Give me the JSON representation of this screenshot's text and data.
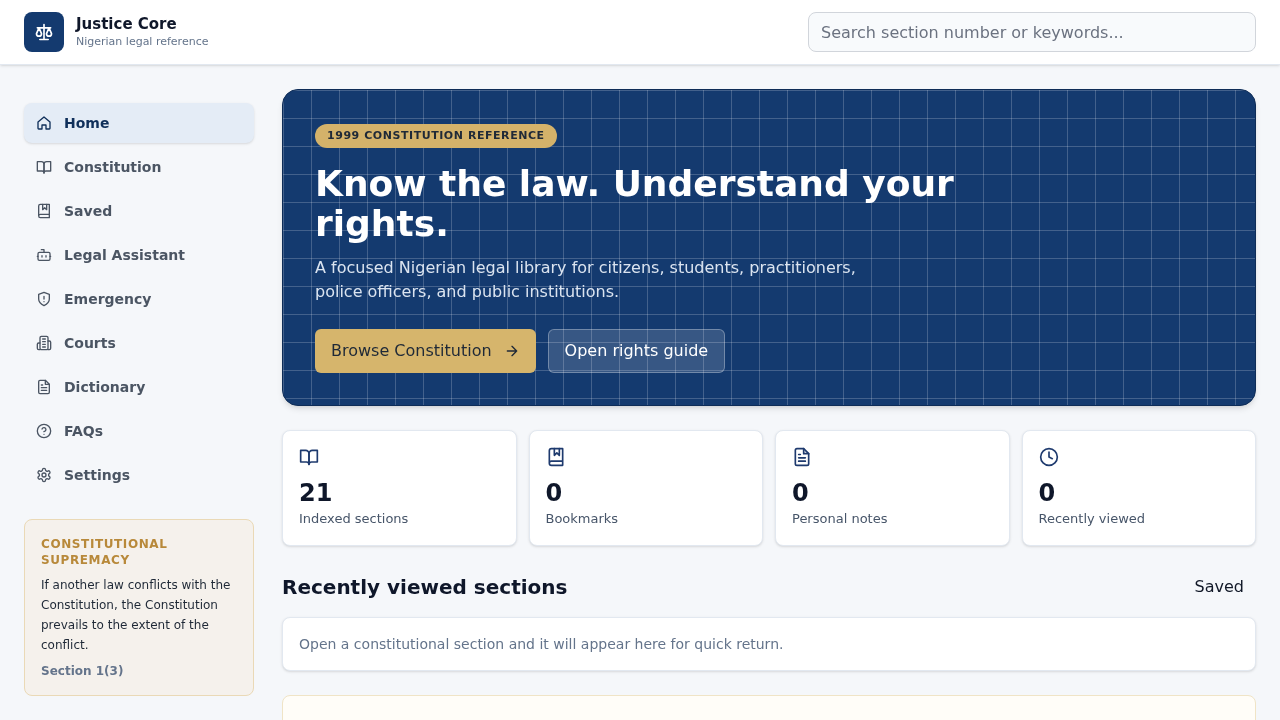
{
  "header": {
    "app_title": "Justice Core",
    "app_subtitle": "Nigerian legal reference",
    "search": {
      "placeholder": "Search section number or keywords..."
    }
  },
  "sidebar": {
    "items": [
      {
        "label": "Home",
        "selected": true
      },
      {
        "label": "Constitution",
        "selected": false
      },
      {
        "label": "Saved",
        "selected": false
      },
      {
        "label": "Legal Assistant",
        "selected": false
      },
      {
        "label": "Emergency",
        "selected": false
      },
      {
        "label": "Courts",
        "selected": false
      },
      {
        "label": "Dictionary",
        "selected": false
      },
      {
        "label": "FAQs",
        "selected": false
      },
      {
        "label": "Settings",
        "selected": false
      }
    ],
    "note": {
      "title": "CONSTITUTIONAL SUPREMACY",
      "body": "If another law conflicts with the Constitution, the Constitution prevails to the extent of the conflict.",
      "reference": "Section 1(3)"
    }
  },
  "hero": {
    "tag": "1999 CONSTITUTION REFERENCE",
    "title": "Know the law. Understand your rights.",
    "description": "A focused Nigerian legal library for citizens, students, practitioners, police officers, and public institutions.",
    "buttons": [
      {
        "label": "Browse Constitution",
        "kind": "primary"
      },
      {
        "label": "Open rights guide",
        "kind": "secondary"
      }
    ]
  },
  "stats": [
    {
      "value": "21",
      "label": "Indexed sections"
    },
    {
      "value": "0",
      "label": "Bookmarks"
    },
    {
      "value": "0",
      "label": "Personal notes"
    },
    {
      "value": "0",
      "label": "Recently viewed"
    }
  ],
  "recent": {
    "title": "Recently viewed sections",
    "link": "Saved",
    "empty_message": "Open a constitutional section and it will appear here for quick return."
  }
}
